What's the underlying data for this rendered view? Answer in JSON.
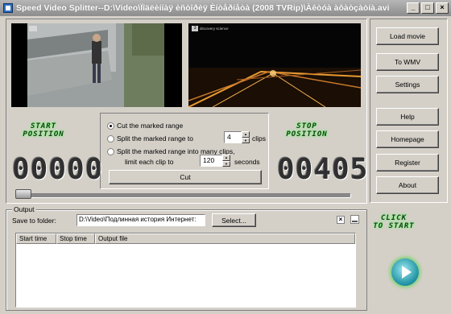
{
  "window": {
    "title": "Speed Video Splitter--D:\\Video\\Ïîäëèííàÿ èñòîðèÿ Èíòåðíåòà (2008 TVRip)\\Àêòóà àôàòçàòíà.avi",
    "minimize": "_",
    "maximize": "□",
    "close": "×"
  },
  "preview_right": {
    "channel_logo": "3",
    "channel_text": "discovery science"
  },
  "positions": {
    "start_label_line1": "START",
    "start_label_line2": "POSITION",
    "start_value": "00000",
    "stop_label_line1": "STOP",
    "stop_label_line2": "POSITION",
    "stop_value": "00405"
  },
  "options": {
    "cut_marked": "Cut the marked range",
    "split_to": "Split the marked range to",
    "clips_value": "4",
    "clips_unit": "clips",
    "split_into": "Split the marked range into many clips,",
    "each_clip": "limit each clip to",
    "seconds_value": "120",
    "seconds_unit": "seconds",
    "cut_button": "Cut",
    "selected": "cut_marked"
  },
  "sidebar": {
    "load_movie": "Load movie",
    "to_wmv": "To WMV",
    "settings": "Settings",
    "help": "Help",
    "homepage": "Homepage",
    "register": "Register",
    "about": "About"
  },
  "output": {
    "group_title": "Output",
    "save_label": "Save to folder:",
    "folder_value": "D:\\Video\\Подлинная история Интернет:",
    "select_button": "Select...",
    "columns": [
      "Start time",
      "Stop time",
      "Output file"
    ],
    "checkbox_mark": "×"
  },
  "click_to_start": {
    "line1": "CLICK",
    "line2": "TO START"
  },
  "slider": {
    "position": 0.0
  }
}
